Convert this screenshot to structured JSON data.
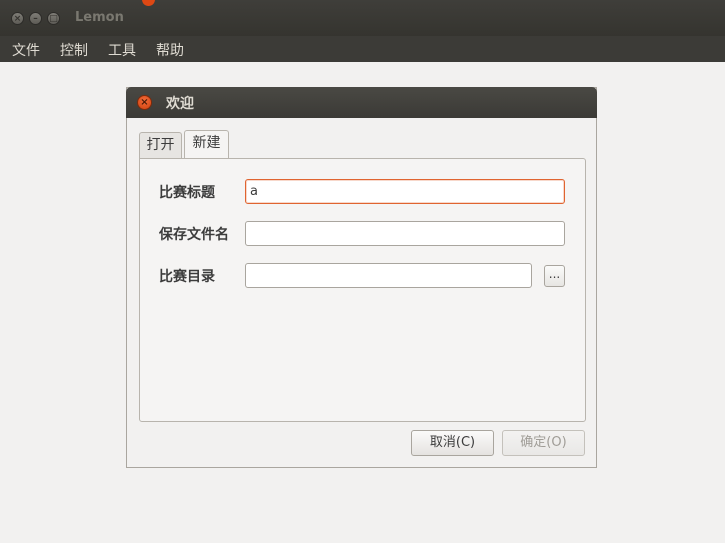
{
  "window": {
    "title": "Lemon",
    "controls": {
      "close": "×",
      "minimize": "–",
      "maximize": "□"
    }
  },
  "menu": {
    "items": [
      {
        "label": "文件"
      },
      {
        "label": "控制"
      },
      {
        "label": "工具"
      },
      {
        "label": "帮助"
      }
    ]
  },
  "dialog": {
    "title": "欢迎",
    "close_glyph": "×",
    "tabs": [
      {
        "label": "打开",
        "active": false
      },
      {
        "label": "新建",
        "active": true
      }
    ],
    "form": {
      "contest_title_label": "比赛标题",
      "contest_title_value": "a",
      "save_filename_label": "保存文件名",
      "save_filename_value": "",
      "contest_dir_label": "比赛目录",
      "contest_dir_value": "",
      "browse_label": "..."
    },
    "buttons": {
      "cancel": "取消(C)",
      "ok": "确定(O)"
    }
  },
  "colors": {
    "accent": "#e06430",
    "titlebar": "#3c3b37",
    "background": "#f2f1f0"
  }
}
